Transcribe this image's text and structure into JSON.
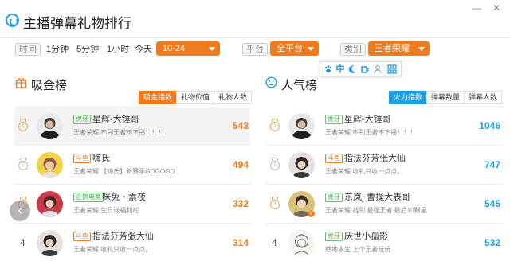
{
  "app": {
    "title": "主播弹幕礼物排行"
  },
  "filters": {
    "time_label": "时间",
    "time_options": [
      "1分钟",
      "5分钟",
      "1小时",
      "今天"
    ],
    "date_value": "10-24",
    "platform_label": "平台",
    "platform_value": "全平台",
    "category_label": "类别",
    "category_value": "王者荣耀"
  },
  "left_panel": {
    "title": "吸金榜",
    "tabs": [
      "吸金指数",
      "礼物价值",
      "礼物人数"
    ],
    "active_tab": 0,
    "rows": [
      {
        "rank": 1,
        "platform": "虎牙",
        "name": "星辉-大锤哥",
        "game": "王者荣耀 不到王者不下播！！！",
        "value": "543"
      },
      {
        "rank": 2,
        "platform": "斗鱼",
        "name": "嗨氏",
        "game": "王者荣耀 【嗨氏】新赛季GOGOGO",
        "value": "494"
      },
      {
        "rank": 3,
        "platform": "企鹅电竞",
        "name": "咪兔・素夜",
        "game": "王者荣耀 生日送福利啦",
        "value": "332"
      },
      {
        "rank": 4,
        "platform": "斗鱼",
        "name": "指法芬芳张大仙",
        "game": "王者荣耀 收礼只收一点点。",
        "value": "314"
      }
    ]
  },
  "right_panel": {
    "title": "人气榜",
    "tabs": [
      "火力指数",
      "弹幕数量",
      "弹幕人数"
    ],
    "active_tab": 0,
    "rows": [
      {
        "rank": 1,
        "platform": "虎牙",
        "name": "星辉-大锤哥",
        "game": "王者荣耀 不到王者不下播！！！",
        "value": "1046"
      },
      {
        "rank": 2,
        "platform": "斗鱼",
        "name": "指法芬芳张大仙",
        "game": "王者荣耀 收礼只收一点点。",
        "value": "747"
      },
      {
        "rank": 3,
        "platform": "虎牙",
        "name": "东岚_曹操大表哥",
        "game": "王者荣耀 战到 最强王者 最后10颗星",
        "value": "545"
      },
      {
        "rank": 4,
        "platform": "虎牙",
        "name": "厌世小孤影",
        "game": "绝地求生 上个王者玩玩",
        "value": "532"
      }
    ]
  },
  "toolbar_icons": [
    "paw-icon",
    "chinese-char-icon",
    "moon-icon",
    "cup-icon",
    "computer-icon",
    "user-icon",
    "grid-icon"
  ],
  "toolbar_glyphs": {
    "zh": "中"
  },
  "colors": {
    "accent_orange": "#f07a1e",
    "accent_blue": "#1ea0e0"
  }
}
